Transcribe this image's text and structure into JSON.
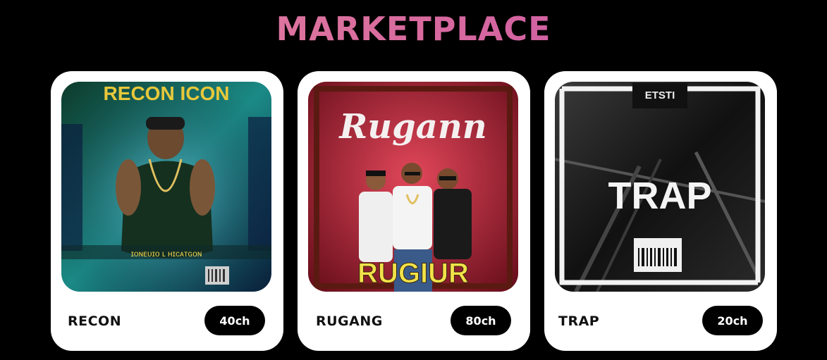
{
  "page": {
    "title": "MARKETPLACE"
  },
  "colors": {
    "title_start": "#e48aa0",
    "title_end": "#c552a8",
    "card_bg": "#ffffff",
    "price_bg": "#000000"
  },
  "cards": [
    {
      "name": "RECON",
      "price": "40ch",
      "cover_text": "RECON ICON",
      "image": "album-cover-recon"
    },
    {
      "name": "RUGANG",
      "price": "80ch",
      "cover_text": "Rugann",
      "cover_text_bottom": "RUGIUR",
      "image": "album-cover-rugang"
    },
    {
      "name": "TRAP",
      "price": "20ch",
      "cover_text": "TRAP",
      "image": "album-cover-trap"
    }
  ]
}
